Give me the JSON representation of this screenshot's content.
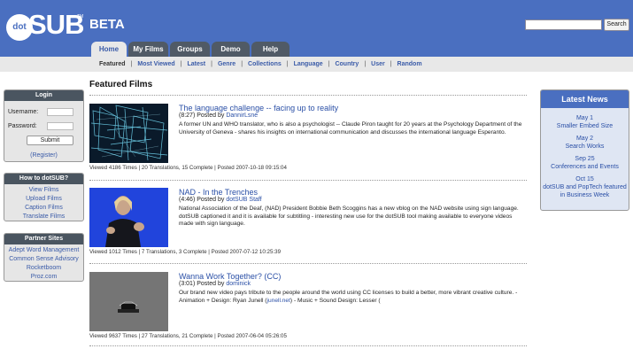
{
  "header": {
    "logo_dot": "dot",
    "logo_sub": "SUB",
    "logo_tm": "TM",
    "beta": "BETA",
    "search_button": "Search",
    "brand_color": "#4a6fc0"
  },
  "tabs": [
    {
      "label": "Home",
      "active": true
    },
    {
      "label": "My Films",
      "active": false
    },
    {
      "label": "Groups",
      "active": false
    },
    {
      "label": "Demo",
      "active": false
    },
    {
      "label": "Help",
      "active": false
    }
  ],
  "subnav": [
    "Featured",
    "Most Viewed",
    "Latest",
    "Genre",
    "Collections",
    "Language",
    "Country",
    "User",
    "Random"
  ],
  "main": {
    "title": "Featured Films",
    "films": [
      {
        "title": "The language challenge -- facing up to reality",
        "duration": "(8:27) Posted by",
        "user": "DannirLsne",
        "description": "A former UN and WHO translator, who is also a psychologist -- Claude Piron taught for 20 years at the Psychology Department of the University of Geneva - shares his insights on international communication and discusses the international language Esperanto.",
        "meta": "Viewed 4186 Times | 20 Translations, 15 Complete | Posted 2007-10-18 09:15:04"
      },
      {
        "title": "NAD - In the Trenches",
        "duration": "(4:46) Posted by",
        "user": "dotSUB Staff",
        "description": "National Association of the Deaf, (NAD) President Bobbie Beth Scoggins has a new vblog on the NAD website using sign language. dotSUB captioned it and it is available for subtitling - interesting new use for the dotSUB tool making available to everyone videos made with sign language.",
        "meta": "Viewed 1012 Times | 7 Translations, 3 Complete | Posted 2007-07-12 10:25:39"
      },
      {
        "title": "Wanna Work Together? (CC)",
        "duration": "(3:01) Posted by",
        "user": "dominick",
        "description_a": "Our brand new video pays tribute to the people around the world using CC licenses to build a better, more vibrant creative culture. - Animation + Design: Ryan Junell (",
        "description_link": "junell.net",
        "description_b": ") - Music + Sound Design: Lesser (",
        "meta": "Viewed 9637 Times | 27 Translations, 21 Complete | Posted 2007-06-04 05:26:05"
      }
    ]
  },
  "login": {
    "title": "Login",
    "username_label": "Username:",
    "password_label": "Password:",
    "submit": "Submit",
    "register": "(Register)"
  },
  "howto": {
    "title": "How to dotSUB?",
    "links": [
      "View Films",
      "Upload Films",
      "Caption Films",
      "Translate Films"
    ]
  },
  "partners": {
    "title": "Partner Sites",
    "links": [
      "Adept Word Management",
      "Common Sense Advisory",
      "Rocketboom",
      "Proz.com"
    ]
  },
  "news": {
    "title": "Latest News",
    "items": [
      {
        "date": "May 1",
        "text": "Smaller Embed Size"
      },
      {
        "date": "May 2",
        "text": "Search Works"
      },
      {
        "date": "Sep 25",
        "text": "Conferences and Events"
      },
      {
        "date": "Oct 15",
        "text": "dotSUB and PopTech featured in Business Week"
      }
    ]
  }
}
